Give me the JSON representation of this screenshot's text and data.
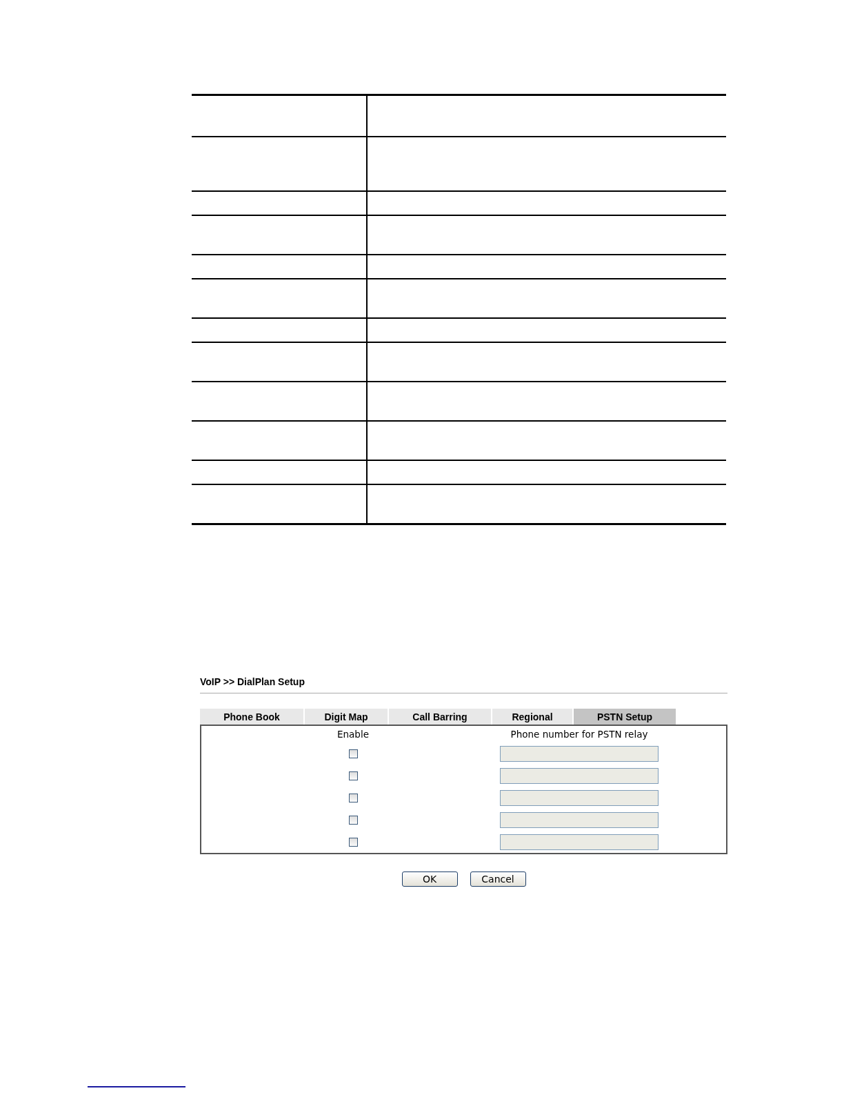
{
  "title": "VoIP >> DialPlan Setup",
  "tabs": [
    {
      "label": "Phone Book",
      "selected": false
    },
    {
      "label": "Digit Map",
      "selected": false
    },
    {
      "label": "Call Barring",
      "selected": false
    },
    {
      "label": "Regional",
      "selected": false
    },
    {
      "label": "PSTN Setup",
      "selected": true
    }
  ],
  "columns": [
    "Enable",
    "Phone number for PSTN relay"
  ],
  "rows": [
    {
      "checked": false
    },
    {
      "checked": false
    },
    {
      "checked": false
    },
    {
      "checked": false
    },
    {
      "checked": false
    }
  ],
  "buttons": [
    "OK",
    "Cancel"
  ]
}
